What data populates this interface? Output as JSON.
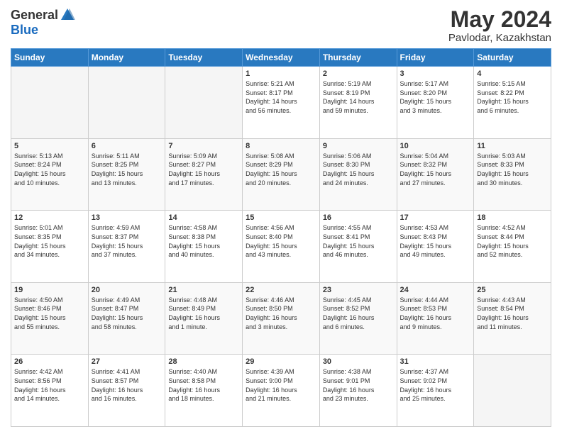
{
  "logo": {
    "general": "General",
    "blue": "Blue"
  },
  "header": {
    "month": "May 2024",
    "location": "Pavlodar, Kazakhstan"
  },
  "weekdays": [
    "Sunday",
    "Monday",
    "Tuesday",
    "Wednesday",
    "Thursday",
    "Friday",
    "Saturday"
  ],
  "weeks": [
    [
      {
        "day": "",
        "info": ""
      },
      {
        "day": "",
        "info": ""
      },
      {
        "day": "",
        "info": ""
      },
      {
        "day": "1",
        "info": "Sunrise: 5:21 AM\nSunset: 8:17 PM\nDaylight: 14 hours\nand 56 minutes."
      },
      {
        "day": "2",
        "info": "Sunrise: 5:19 AM\nSunset: 8:19 PM\nDaylight: 14 hours\nand 59 minutes."
      },
      {
        "day": "3",
        "info": "Sunrise: 5:17 AM\nSunset: 8:20 PM\nDaylight: 15 hours\nand 3 minutes."
      },
      {
        "day": "4",
        "info": "Sunrise: 5:15 AM\nSunset: 8:22 PM\nDaylight: 15 hours\nand 6 minutes."
      }
    ],
    [
      {
        "day": "5",
        "info": "Sunrise: 5:13 AM\nSunset: 8:24 PM\nDaylight: 15 hours\nand 10 minutes."
      },
      {
        "day": "6",
        "info": "Sunrise: 5:11 AM\nSunset: 8:25 PM\nDaylight: 15 hours\nand 13 minutes."
      },
      {
        "day": "7",
        "info": "Sunrise: 5:09 AM\nSunset: 8:27 PM\nDaylight: 15 hours\nand 17 minutes."
      },
      {
        "day": "8",
        "info": "Sunrise: 5:08 AM\nSunset: 8:29 PM\nDaylight: 15 hours\nand 20 minutes."
      },
      {
        "day": "9",
        "info": "Sunrise: 5:06 AM\nSunset: 8:30 PM\nDaylight: 15 hours\nand 24 minutes."
      },
      {
        "day": "10",
        "info": "Sunrise: 5:04 AM\nSunset: 8:32 PM\nDaylight: 15 hours\nand 27 minutes."
      },
      {
        "day": "11",
        "info": "Sunrise: 5:03 AM\nSunset: 8:33 PM\nDaylight: 15 hours\nand 30 minutes."
      }
    ],
    [
      {
        "day": "12",
        "info": "Sunrise: 5:01 AM\nSunset: 8:35 PM\nDaylight: 15 hours\nand 34 minutes."
      },
      {
        "day": "13",
        "info": "Sunrise: 4:59 AM\nSunset: 8:37 PM\nDaylight: 15 hours\nand 37 minutes."
      },
      {
        "day": "14",
        "info": "Sunrise: 4:58 AM\nSunset: 8:38 PM\nDaylight: 15 hours\nand 40 minutes."
      },
      {
        "day": "15",
        "info": "Sunrise: 4:56 AM\nSunset: 8:40 PM\nDaylight: 15 hours\nand 43 minutes."
      },
      {
        "day": "16",
        "info": "Sunrise: 4:55 AM\nSunset: 8:41 PM\nDaylight: 15 hours\nand 46 minutes."
      },
      {
        "day": "17",
        "info": "Sunrise: 4:53 AM\nSunset: 8:43 PM\nDaylight: 15 hours\nand 49 minutes."
      },
      {
        "day": "18",
        "info": "Sunrise: 4:52 AM\nSunset: 8:44 PM\nDaylight: 15 hours\nand 52 minutes."
      }
    ],
    [
      {
        "day": "19",
        "info": "Sunrise: 4:50 AM\nSunset: 8:46 PM\nDaylight: 15 hours\nand 55 minutes."
      },
      {
        "day": "20",
        "info": "Sunrise: 4:49 AM\nSunset: 8:47 PM\nDaylight: 15 hours\nand 58 minutes."
      },
      {
        "day": "21",
        "info": "Sunrise: 4:48 AM\nSunset: 8:49 PM\nDaylight: 16 hours\nand 1 minute."
      },
      {
        "day": "22",
        "info": "Sunrise: 4:46 AM\nSunset: 8:50 PM\nDaylight: 16 hours\nand 3 minutes."
      },
      {
        "day": "23",
        "info": "Sunrise: 4:45 AM\nSunset: 8:52 PM\nDaylight: 16 hours\nand 6 minutes."
      },
      {
        "day": "24",
        "info": "Sunrise: 4:44 AM\nSunset: 8:53 PM\nDaylight: 16 hours\nand 9 minutes."
      },
      {
        "day": "25",
        "info": "Sunrise: 4:43 AM\nSunset: 8:54 PM\nDaylight: 16 hours\nand 11 minutes."
      }
    ],
    [
      {
        "day": "26",
        "info": "Sunrise: 4:42 AM\nSunset: 8:56 PM\nDaylight: 16 hours\nand 14 minutes."
      },
      {
        "day": "27",
        "info": "Sunrise: 4:41 AM\nSunset: 8:57 PM\nDaylight: 16 hours\nand 16 minutes."
      },
      {
        "day": "28",
        "info": "Sunrise: 4:40 AM\nSunset: 8:58 PM\nDaylight: 16 hours\nand 18 minutes."
      },
      {
        "day": "29",
        "info": "Sunrise: 4:39 AM\nSunset: 9:00 PM\nDaylight: 16 hours\nand 21 minutes."
      },
      {
        "day": "30",
        "info": "Sunrise: 4:38 AM\nSunset: 9:01 PM\nDaylight: 16 hours\nand 23 minutes."
      },
      {
        "day": "31",
        "info": "Sunrise: 4:37 AM\nSunset: 9:02 PM\nDaylight: 16 hours\nand 25 minutes."
      },
      {
        "day": "",
        "info": ""
      }
    ]
  ]
}
